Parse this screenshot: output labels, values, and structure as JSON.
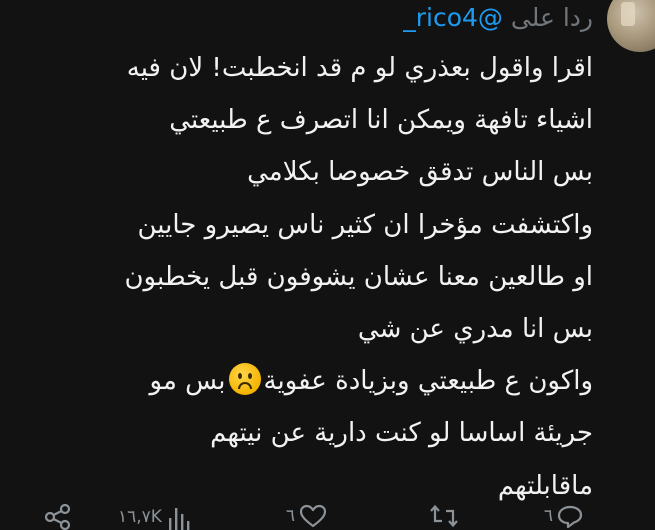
{
  "reply_to": {
    "prefix": "ردا على",
    "handle": "@rico4_"
  },
  "tweet": {
    "lines": [
      "اقرا واقول بعذري لو م قد انخطبت! لان فيه",
      "اشياء تافهة ويمكن انا اتصرف ع طبيعتي",
      "بس الناس تدقق خصوصا بكلامي",
      "واكتشفت مؤخرا ان كثير ناس يصيرو جايين",
      "او طالعين معنا عشان يشوفون قبل يخطبون",
      "بس انا مدري عن شي",
      "جريئة  اساسا لو كنت دارية عن نيتهم",
      "ماقابلتهم"
    ],
    "emoji_line": {
      "before": "واكون ع طبيعتي وبزيادة عفوية",
      "emoji": "frowning-face-icon",
      "after": "بس مو"
    }
  },
  "actions": {
    "reply_count": "٦",
    "retweet_count": "",
    "like_count": "٦",
    "views_count": "١٦,٧K",
    "share_label": ""
  },
  "colors": {
    "background": "#121212",
    "text": "#f2f2f2",
    "muted": "#71767b",
    "link": "#1d9bf0"
  }
}
